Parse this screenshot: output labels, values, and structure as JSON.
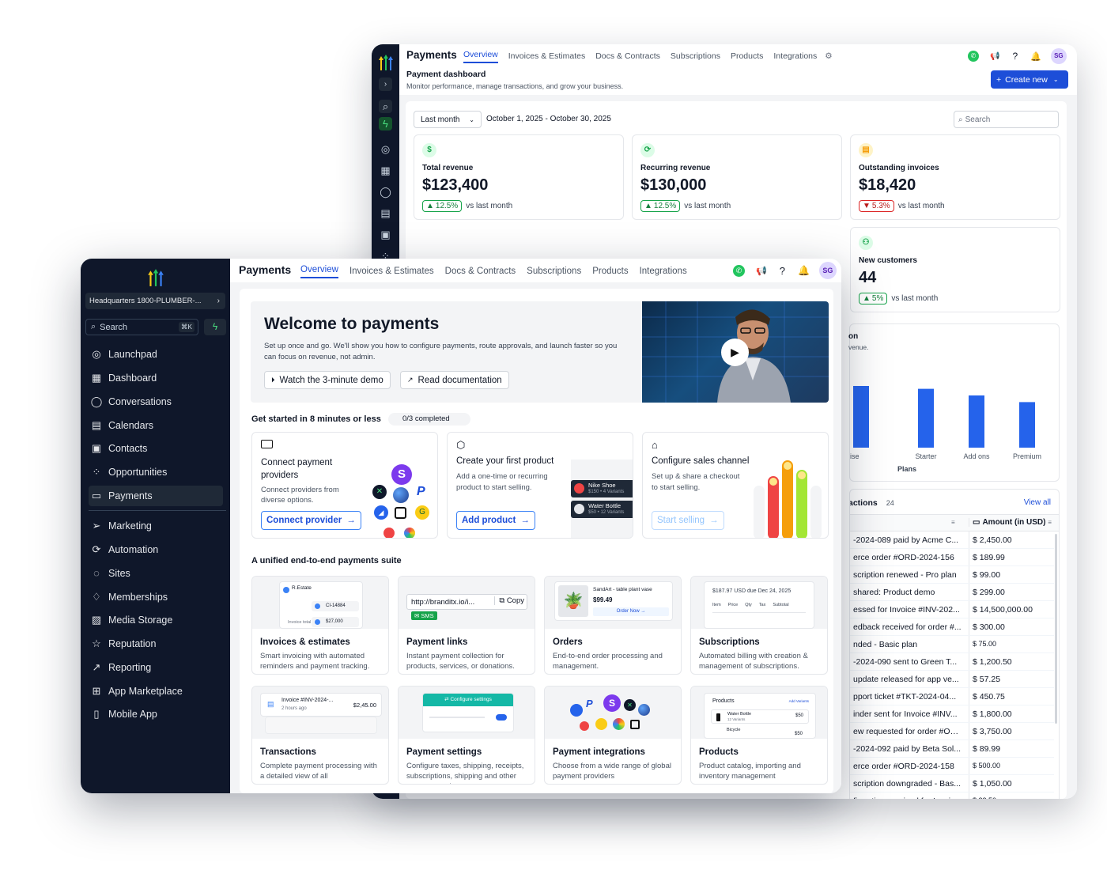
{
  "back": {
    "app_title": "Payments",
    "nav": [
      "Overview",
      "Invoices & Estimates",
      "Docs & Contracts",
      "Subscriptions",
      "Products",
      "Integrations"
    ],
    "avatar": "SG",
    "page_title": "Payment dashboard",
    "page_subtitle": "Monitor performance, manage transactions, and grow your business.",
    "create_button": "Create new",
    "range_select": "Last month",
    "date_range": "October 1, 2025 - October 30, 2025",
    "search_placeholder": "Search",
    "stats": [
      {
        "label": "Total revenue",
        "value": "$123,400",
        "change": "12.5%",
        "direction": "up",
        "note": "vs last month",
        "icon": "dollar-icon",
        "color": "#16a34a"
      },
      {
        "label": "Recurring revenue",
        "value": "$130,000",
        "change": "12.5%",
        "direction": "up",
        "note": "vs last month",
        "icon": "refresh-icon",
        "color": "#16a34a"
      },
      {
        "label": "Outstanding invoices",
        "value": "$18,420",
        "change": "5.3%",
        "direction": "down",
        "note": "vs last month",
        "icon": "invoice-icon",
        "color": "#f59e0b"
      },
      {
        "label": "New customers",
        "value": "44",
        "change": "5%",
        "direction": "up",
        "note": "vs last month",
        "icon": "users-icon",
        "color": "#16a34a"
      }
    ],
    "chart_partial_title": "on",
    "chart_partial_sub": "venue.",
    "transactions_title": "actions",
    "transactions_count": "24",
    "view_all": "View all",
    "amount_header": "Amount (in USD)",
    "transactions": [
      {
        "desc": "-2024-089 paid by Acme C...",
        "amount": "$ 2,450.00"
      },
      {
        "desc": "erce order #ORD-2024-156",
        "amount": "$ 189.99"
      },
      {
        "desc": "scription renewed - Pro plan",
        "amount": "$ 99.00"
      },
      {
        "desc": "shared: Product demo",
        "amount": "$ 299.00"
      },
      {
        "desc": "essed for Invoice #INV-202...",
        "amount": "$ 14,500,000.00"
      },
      {
        "desc": "edback received for order #...",
        "amount": "$ 300.00"
      },
      {
        "desc": "nded - Basic plan",
        "amount": "$ 75.00"
      },
      {
        "desc": "-2024-090 sent to Green T...",
        "amount": "$ 1,200.50"
      },
      {
        "desc": "update released for app ve...",
        "amount": "$ 57.25"
      },
      {
        "desc": "pport ticket #TKT-2024-04...",
        "amount": "$ 450.75"
      },
      {
        "desc": "inder sent for Invoice #INV...",
        "amount": "$ 1,800.00"
      },
      {
        "desc": "ew requested for order #OR...",
        "amount": "$ 3,750.00"
      },
      {
        "desc": "-2024-092 paid by Beta Sol...",
        "amount": "$ 89.99"
      },
      {
        "desc": "erce order #ORD-2024-158",
        "amount": "$ 500.00"
      },
      {
        "desc": "scription downgraded - Bas...",
        "amount": "$ 1,050.00"
      },
      {
        "desc": "firmation received for Invoi...",
        "amount": "$ 22.50"
      }
    ]
  },
  "chart_data": {
    "type": "bar",
    "categories": [
      "ise",
      "Starter",
      "Add ons",
      "Premium"
    ],
    "values": [
      65,
      62,
      55,
      48
    ],
    "xlabel": "Plans",
    "ylabel": "",
    "ylim": [
      0,
      100
    ],
    "color": "#2563eb",
    "grid": false
  },
  "front": {
    "app_title": "Payments",
    "nav": [
      "Overview",
      "Invoices & Estimates",
      "Docs & Contracts",
      "Subscriptions",
      "Products",
      "Integrations"
    ],
    "avatar": "SG",
    "location": "Headquarters 1800-PLUMBER-...",
    "search_placeholder": "Search",
    "search_shortcut": "⌘K",
    "sidebar": [
      {
        "label": "Launchpad",
        "icon": "launchpad-icon"
      },
      {
        "label": "Dashboard",
        "icon": "dashboard-icon"
      },
      {
        "label": "Conversations",
        "icon": "chat-icon"
      },
      {
        "label": "Calendars",
        "icon": "calendar-icon"
      },
      {
        "label": "Contacts",
        "icon": "contacts-icon"
      },
      {
        "label": "Opportunities",
        "icon": "opportunities-icon"
      },
      {
        "label": "Payments",
        "icon": "payments-icon"
      },
      {
        "label": "Marketing",
        "icon": "marketing-icon"
      },
      {
        "label": "Automation",
        "icon": "automation-icon"
      },
      {
        "label": "Sites",
        "icon": "sites-icon"
      },
      {
        "label": "Memberships",
        "icon": "memberships-icon"
      },
      {
        "label": "Media Storage",
        "icon": "media-icon"
      },
      {
        "label": "Reputation",
        "icon": "star-icon"
      },
      {
        "label": "Reporting",
        "icon": "reporting-icon"
      },
      {
        "label": "App Marketplace",
        "icon": "apps-icon"
      },
      {
        "label": "Mobile App",
        "icon": "mobile-icon"
      }
    ],
    "welcome": {
      "title": "Welcome to payments",
      "body": "Set up once and go. We'll show you how to configure payments, route approvals, and launch faster so you can focus on revenue, not admin.",
      "demo_button": "Watch the 3-minute demo",
      "docs_button": "Read documentation"
    },
    "get_started": {
      "title": "Get started in 8 minutes or less",
      "progress": "0/3 completed",
      "progress_fraction": 0
    },
    "steps": [
      {
        "title": "Connect payment providers",
        "desc": "Connect providers from diverse options.",
        "button": "Connect provider",
        "icon": "card-icon"
      },
      {
        "title": "Create your first product",
        "desc": "Add a one-time or recurring product to start selling.",
        "button": "Add product",
        "icon": "box-icon",
        "products": [
          {
            "name": "Nike Shoe",
            "meta": "$150 • 4 Variants"
          },
          {
            "name": "Water Bottle",
            "meta": "$50 • 12 Variants"
          }
        ]
      },
      {
        "title": "Configure sales channel",
        "desc": "Set up & share a checkout to start selling.",
        "button": "Start selling",
        "icon": "tag-icon"
      }
    ],
    "suite_title": "A unified end-to-end payments suite",
    "tiles": [
      {
        "title": "Invoices & estimates",
        "desc": "Smart invoicing with automated reminders and payment tracking."
      },
      {
        "title": "Payment links",
        "desc": "Instant payment collection for products, services, or donations."
      },
      {
        "title": "Orders",
        "desc": "End-to-end order processing and management."
      },
      {
        "title": "Subscriptions",
        "desc": "Automated billing with creation & management of subscriptions."
      },
      {
        "title": "Transactions",
        "desc": "Complete payment processing with a detailed view of all"
      },
      {
        "title": "Payment settings",
        "desc": "Configure taxes, shipping, receipts, subscriptions, shipping and other payment settings"
      },
      {
        "title": "Payment integrations",
        "desc": "Choose from a wide range of global payment providers"
      },
      {
        "title": "Products",
        "desc": "Product catalog, importing and inventory management"
      }
    ],
    "thumbs": {
      "invoice_label": "R.Estate",
      "invoice_id": "CI-14884",
      "invoice_total_label": "Invoice total",
      "invoice_total": "$27,000",
      "link_url": "http://branditx.io/i...",
      "copy": "Copy",
      "sms": "SMS",
      "order_product": "SandArt - table plant vase",
      "order_price": "$99.49",
      "order_now": "Order Now",
      "sub_due": "$187.97 USD due Dec 24, 2025",
      "sub_cols": [
        "Item",
        "Price",
        "Qty",
        "Tax",
        "Subtotal"
      ],
      "txn_title": "Invoice #INV-2024-...",
      "txn_time": "2 hours ago",
      "txn_amount": "$2,45.00",
      "settings_label": "Configure settings",
      "products_header": "Products",
      "products_add": "Add Variants",
      "prod1": "Water Bottle",
      "prod1_meta": "12 Variants",
      "prod1_price": "$50",
      "prod2": "Bicycle",
      "prod2_price": "$50"
    }
  }
}
